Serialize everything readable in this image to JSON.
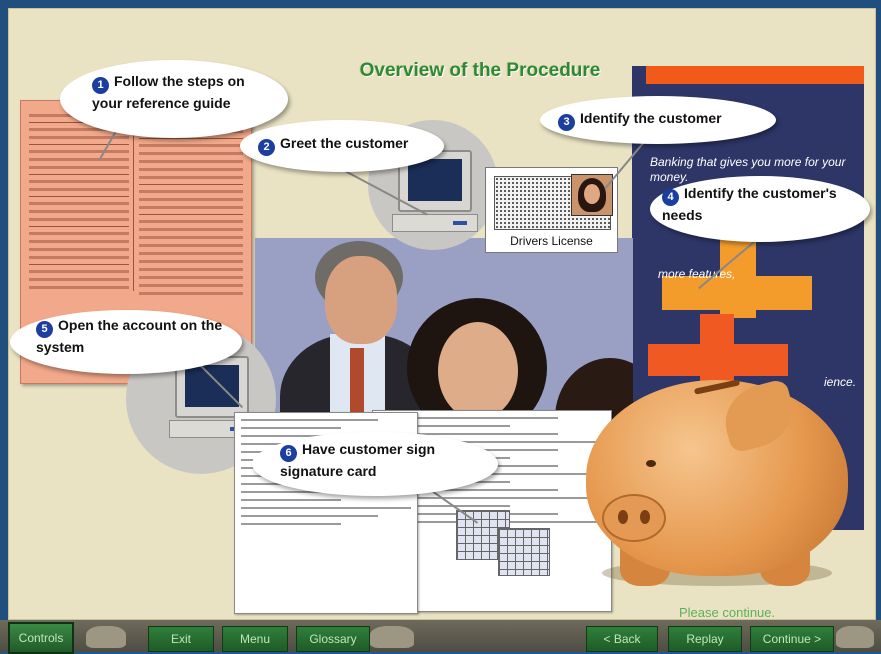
{
  "title": "Overview of the Procedure",
  "steps": [
    {
      "num": "1",
      "text": "Follow the steps on your reference guide"
    },
    {
      "num": "2",
      "text": "Greet the customer"
    },
    {
      "num": "3",
      "text": "Identify the customer"
    },
    {
      "num": "4",
      "text": "Identify the customer's needs"
    },
    {
      "num": "5",
      "text": "Open the account on the system"
    },
    {
      "num": "6",
      "text": "Have customer sign signature card"
    }
  ],
  "license_caption": "Drivers License",
  "brochure": {
    "tagline": "Banking that gives you more for your money.",
    "more": "more features,",
    "ience": "ience."
  },
  "status_message": "Please continue.",
  "nav": {
    "controls": "Controls",
    "exit": "Exit",
    "menu": "Menu",
    "glossary": "Glossary",
    "back": "< Back",
    "replay": "Replay",
    "continue": "Continue >"
  },
  "colors": {
    "frame": "#214f7d",
    "background": "#e9e3c4",
    "title": "#2f8a2f",
    "nav_button": "#2f7f3a",
    "step_number": "#1c3e9e",
    "status_text": "#5db05a"
  },
  "icons": [
    "monitor-icon",
    "drivers-license-card",
    "piggy-bank-icon",
    "signature-card-form"
  ]
}
